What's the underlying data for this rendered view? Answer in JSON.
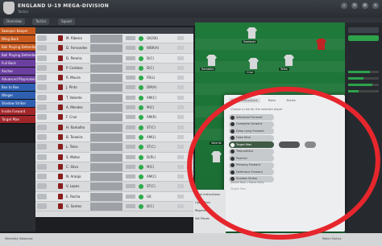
{
  "header": {
    "title": "ENGLAND U-19 MEGA-DIVISION",
    "subtitle": "Tactics"
  },
  "tabs": [
    "Overview",
    "Tactics",
    "Squad"
  ],
  "roles": [
    "Sweeper Keeper",
    "Wing Back",
    "Ball Playing Defender",
    "Ball Playing Defender",
    "Full Back",
    "Anchor",
    "Advanced Playmaker",
    "Box to Box",
    "Winger",
    "Shadow Striker",
    "Inside Forward",
    "Target Man"
  ],
  "players": [
    {
      "name": "M. Ribeiro",
      "role": "GK(SK)",
      "status": "green"
    },
    {
      "name": "D. Fernandes",
      "role": "WBR(A)",
      "status": "green"
    },
    {
      "name": "D. Pereira",
      "role": "D(C)",
      "status": "green"
    },
    {
      "name": "P. Cardoso",
      "role": "D(C)",
      "status": "green"
    },
    {
      "name": "R. Moura",
      "role": "FB(L)",
      "status": "green"
    },
    {
      "name": "J. Pinto",
      "role": "DM(A)",
      "status": "green"
    },
    {
      "name": "T. Valente",
      "role": "AM(C)",
      "status": "green"
    },
    {
      "name": "A. Mendes",
      "role": "M(C)",
      "status": "green"
    },
    {
      "name": "F. Cruz",
      "role": "AM(R)",
      "status": "green"
    },
    {
      "name": "H. Ramalho",
      "role": "ST(C)",
      "status": "green"
    },
    {
      "name": "B. Teixeira",
      "role": "AM(L)",
      "status": "green"
    },
    {
      "name": "L. Teles",
      "role": "ST(C)",
      "status": "green"
    },
    {
      "name": "S. Matos",
      "role": "D(RL)",
      "status": "green"
    },
    {
      "name": "C. Silva",
      "role": "M(C)",
      "status": "green"
    },
    {
      "name": "N. Araújo",
      "role": "AM(C)",
      "status": "green"
    },
    {
      "name": "V. Lopes",
      "role": "ST(C)",
      "status": "green"
    },
    {
      "name": "E. Rocha",
      "role": "GK",
      "status": "green"
    },
    {
      "name": "G. Santos",
      "role": "D(C)",
      "status": "green"
    }
  ],
  "pitch_labels": [
    "Sweeper",
    "Ramalho",
    "Cruz",
    "Teles",
    "Valente"
  ],
  "popup": {
    "tabs": [
      "Player Instructions",
      "Roles",
      "Duties"
    ],
    "subtitle": "Choose a role for the selected player",
    "options": [
      "Advanced Forward",
      "Complete Forward",
      "Deep Lying Forward",
      "False Nine",
      "Target Man",
      "Trequartista",
      "Poacher",
      "Pressing Forward",
      "Defensive Forward",
      "Shadow Striker"
    ],
    "footer": "Select Role / Move Duty",
    "footer2": "Target Man"
  },
  "right_panel": {
    "buttons": [
      "Quick Pick",
      "Overview"
    ],
    "bars": [
      0.7,
      0.5,
      0.8,
      0.35
    ]
  },
  "bottom": {
    "lines": [
      "Team Instructions",
      "Opposition",
      "Regenerate",
      "Set Pieces"
    ],
    "footer_left": "Mentality: Balanced",
    "footer_right": "Match Tactics"
  },
  "colors": {
    "accent": "#2da24a",
    "annotation": "#e6262c",
    "pitch": "#1f7a3a"
  }
}
